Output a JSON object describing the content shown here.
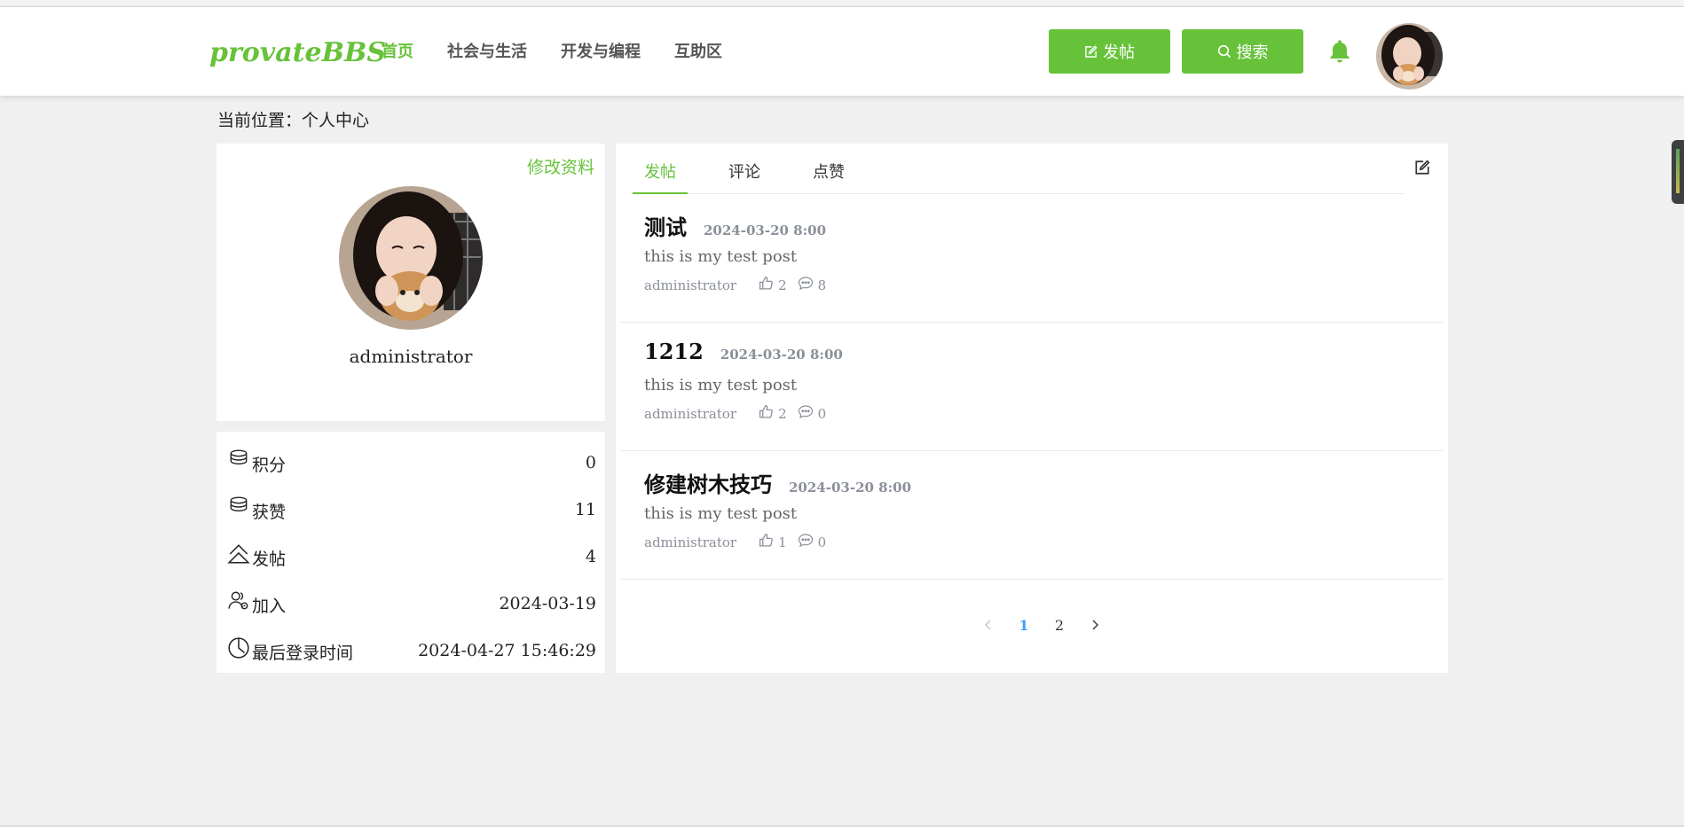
{
  "header": {
    "logo": "provateBBS",
    "nav": [
      {
        "label": "首页",
        "active": true
      },
      {
        "label": "社会与生活",
        "active": false
      },
      {
        "label": "开发与编程",
        "active": false
      },
      {
        "label": "互助区",
        "active": false
      }
    ],
    "post_button": "发帖",
    "search_button": "搜索",
    "accent_color": "#67c23a"
  },
  "breadcrumb": "当前位置：个人中心",
  "profile": {
    "edit_label": "修改资料",
    "username": "administrator"
  },
  "stats": [
    {
      "icon": "coins-icon",
      "label": "积分",
      "value": "0"
    },
    {
      "icon": "coins-icon",
      "label": "获赞",
      "value": "11"
    },
    {
      "icon": "home-icon",
      "label": "发帖",
      "value": "4"
    },
    {
      "icon": "users-icon",
      "label": "加入",
      "value": "2024-03-19"
    },
    {
      "icon": "clock-icon",
      "label": "最后登录时间",
      "value": "2024-04-27 15:46:29"
    }
  ],
  "tabs": [
    {
      "label": "发帖",
      "active": true
    },
    {
      "label": "评论",
      "active": false
    },
    {
      "label": "点赞",
      "active": false
    }
  ],
  "posts": [
    {
      "title": "测试",
      "date": "2024-03-20 8:00",
      "excerpt": "this is my test post",
      "author": "administrator",
      "likes": "2",
      "comments": "8"
    },
    {
      "title": "1212",
      "date": "2024-03-20 8:00",
      "excerpt": "this is my test post",
      "author": "administrator",
      "likes": "2",
      "comments": "0"
    },
    {
      "title": "修建树木技巧",
      "date": "2024-03-20 8:00",
      "excerpt": "this is my test post",
      "author": "administrator",
      "likes": "1",
      "comments": "0"
    }
  ],
  "pagination": {
    "pages": [
      "1",
      "2"
    ],
    "current": "1"
  }
}
